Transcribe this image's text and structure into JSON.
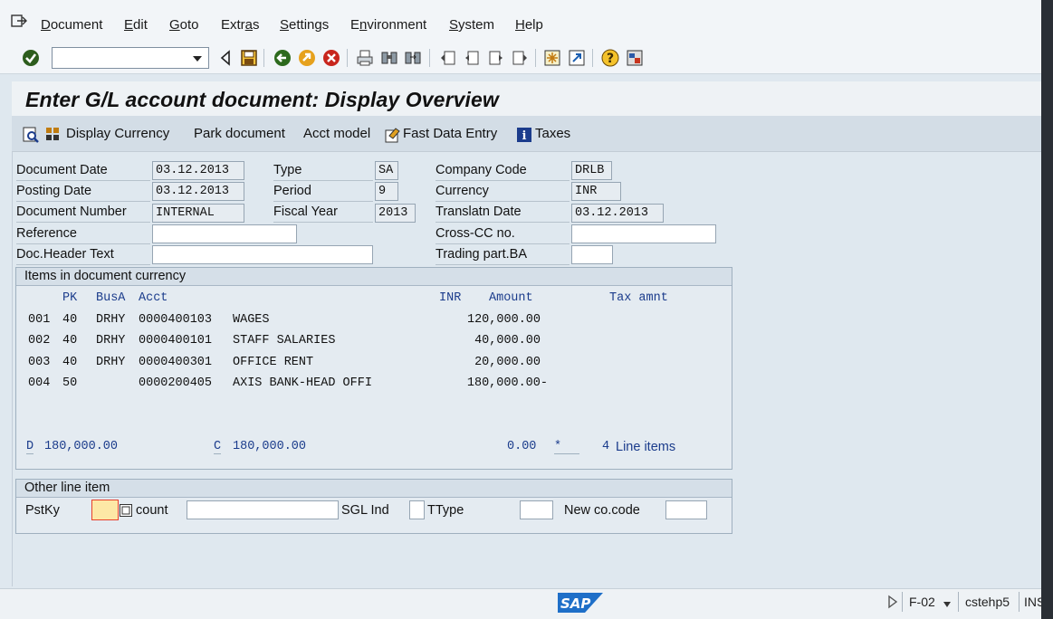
{
  "menu": {
    "items": [
      {
        "pre": "",
        "ul": "D",
        "post": "ocument"
      },
      {
        "pre": "",
        "ul": "E",
        "post": "dit"
      },
      {
        "pre": "",
        "ul": "G",
        "post": "oto"
      },
      {
        "pre": "Extr",
        "ul": "a",
        "post": "s"
      },
      {
        "pre": "",
        "ul": "S",
        "post": "ettings"
      },
      {
        "pre": "E",
        "ul": "n",
        "post": "vironment"
      },
      {
        "pre": "",
        "ul": "S",
        "post": "ystem"
      },
      {
        "pre": "",
        "ul": "H",
        "post": "elp"
      }
    ]
  },
  "toolbar": {
    "command_value": "",
    "icons": [
      "enter-icon",
      "back-icon",
      "save-icon",
      "back-green-icon",
      "exit-icon",
      "cancel-icon",
      "print-icon",
      "find-icon",
      "find-next-icon",
      "first-page-icon",
      "previous-page-icon",
      "next-page-icon",
      "last-page-icon",
      "create-session-icon",
      "shortcut-icon",
      "help-icon",
      "customize-layout-icon"
    ]
  },
  "page": {
    "title": "Enter G/L account document: Display Overview"
  },
  "appbar": {
    "display_currency": "Display Currency",
    "park_document": "Park document",
    "acct_model": "Acct model",
    "fast_data_entry": "Fast Data Entry",
    "taxes": "Taxes"
  },
  "header": {
    "document_date_label": "Document Date",
    "document_date": "03.12.2013",
    "posting_date_label": "Posting Date",
    "posting_date": "03.12.2013",
    "document_number_label": "Document Number",
    "document_number": "INTERNAL",
    "reference_label": "Reference",
    "reference": "",
    "doc_header_text_label": "Doc.Header Text",
    "doc_header_text": "",
    "type_label": "Type",
    "type": "SA",
    "period_label": "Period",
    "period": "9",
    "fiscal_year_label": "Fiscal Year",
    "fiscal_year": "2013",
    "company_code_label": "Company Code",
    "company_code": "DRLB",
    "currency_label": "Currency",
    "currency": "INR",
    "translatn_date_label": "Translatn Date",
    "translatn_date": "03.12.2013",
    "cross_cc_label": "Cross-CC no.",
    "cross_cc": "",
    "trading_part_label": "Trading part.BA",
    "trading_part": ""
  },
  "items_group": {
    "title": "Items in document currency",
    "columns": {
      "pk": "PK",
      "busa": "BusA",
      "acct": "Acct",
      "curr": "INR",
      "amount": "Amount",
      "tax": "Tax amnt"
    },
    "rows": [
      {
        "no": "001",
        "pk": "40",
        "busa": "DRHY",
        "acct": "0000400103",
        "text": "WAGES",
        "amount": "120,000.00"
      },
      {
        "no": "002",
        "pk": "40",
        "busa": "DRHY",
        "acct": "0000400101",
        "text": "STAFF SALARIES",
        "amount": "40,000.00"
      },
      {
        "no": "003",
        "pk": "40",
        "busa": "DRHY",
        "acct": "0000400301",
        "text": "OFFICE RENT",
        "amount": "20,000.00"
      },
      {
        "no": "004",
        "pk": "50",
        "busa": "",
        "acct": "0000200405",
        "text": "AXIS BANK-HEAD OFFI",
        "amount": "180,000.00-"
      }
    ],
    "totals": {
      "debit_prefix": "D",
      "debit": "180,000.00",
      "credit_prefix": "C",
      "credit": "180,000.00",
      "balance": "0.00",
      "balance_flag": "*",
      "line_items_count": "4",
      "line_items_label": "Line items"
    }
  },
  "other_item": {
    "title": "Other line item",
    "pstky_label": "PstKy",
    "pstky": "",
    "account_label": "count",
    "account": "",
    "sgl_label": "SGL Ind",
    "sgl": "",
    "ttype_label": "TType",
    "ttype": "",
    "new_cocode_label": "New co.code",
    "new_cocode": ""
  },
  "status": {
    "transaction": "F-02",
    "system": "cstehp5",
    "mode": "INS"
  },
  "colors": {
    "accent_blue": "#1b3c8c",
    "focus_field": "#fde8a6",
    "focus_border": "#e8412c"
  }
}
